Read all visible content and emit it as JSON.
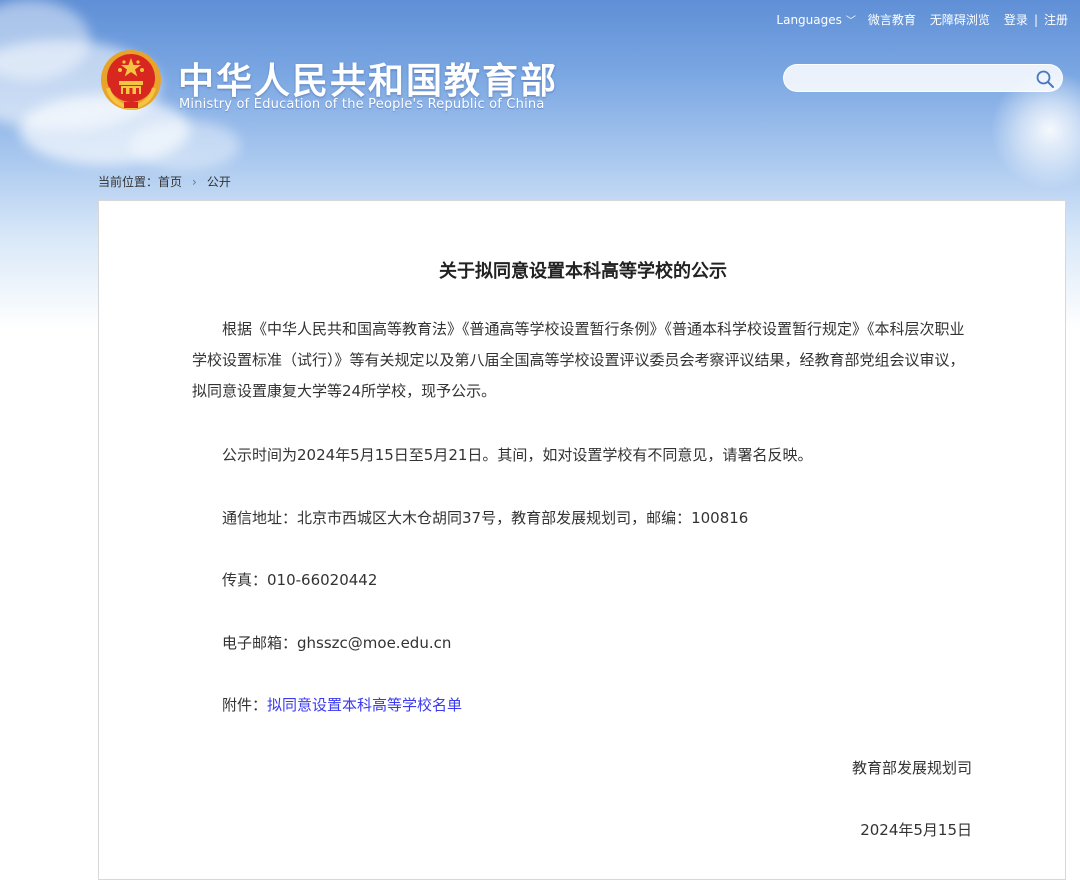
{
  "topnav": {
    "languages": "Languages",
    "weibo": "微言教育",
    "accessible": "无障碍浏览",
    "login": "登录",
    "separator": "|",
    "register": "注册"
  },
  "header": {
    "title_cn": "中华人民共和国教育部",
    "title_en": "Ministry of Education of the People's Republic of China"
  },
  "search": {
    "placeholder": ""
  },
  "breadcrumb": {
    "prefix": "当前位置：",
    "home": "首页",
    "arrow": "›",
    "current": "公开"
  },
  "article": {
    "title": "关于拟同意设置本科高等学校的公示",
    "paragraph1": "根据《中华人民共和国高等教育法》《普通高等学校设置暂行条例》《普通本科学校设置暂行规定》《本科层次职业学校设置标准（试行）》等有关规定以及第八届全国高等学校设置评议委员会考察评议结果，经教育部党组会议审议，拟同意设置康复大学等24所学校，现予公示。",
    "paragraph2": "公示时间为2024年5月15日至5月21日。其间，如对设置学校有不同意见，请署名反映。",
    "address": "通信地址：北京市西城区大木仓胡同37号，教育部发展规划司，邮编：100816",
    "fax": "传真：010-66020442",
    "email": "电子邮箱：ghsszc@moe.edu.cn",
    "attachment_label": "附件：",
    "attachment_link": "拟同意设置本科高等学校名单",
    "signature": "教育部发展规划司",
    "date": "2024年5月15日"
  },
  "colors": {
    "link": "#3a3af0",
    "header_blue": "#5f8fd6"
  }
}
